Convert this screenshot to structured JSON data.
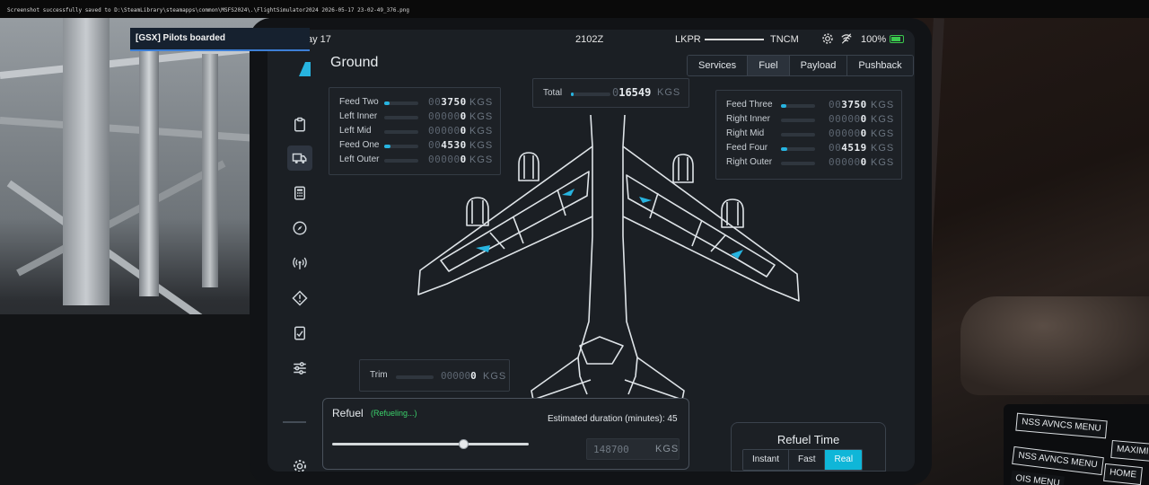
{
  "system_notice": "Screenshot successfully saved to D:\\SteamLibrary\\steamapps\\common\\MSFS2024\\.\\FlightSimulator2024 2026-05-17 23-02-49_376.png",
  "toast": "[GSX] Pilots boarded",
  "status_bar": {
    "date": "ay 17",
    "zulu_time": "2102Z",
    "departure": "LKPR",
    "arrival": "TNCM",
    "battery": "100%",
    "battery_color": "#3ac94d"
  },
  "page_title": "Ground",
  "tabs": [
    "Services",
    "Fuel",
    "Payload",
    "Pushback"
  ],
  "active_tab": "Fuel",
  "accent_color": "#27b4e0",
  "nav_icons": [
    "clipboard-icon",
    "truck-icon",
    "calculator-icon",
    "compass-icon",
    "radio-signal-icon",
    "warning-icon",
    "checklist-icon",
    "sliders-icon",
    "settings-icon"
  ],
  "left_tanks": [
    {
      "name": "Feed Two",
      "lead": "00",
      "value": "3750",
      "unit": "KGS",
      "level": 0.15
    },
    {
      "name": "Left Inner",
      "lead": "00000",
      "value": "0",
      "unit": "KGS",
      "level": 0
    },
    {
      "name": "Left Mid",
      "lead": "00000",
      "value": "0",
      "unit": "KGS",
      "level": 0
    },
    {
      "name": "Feed One",
      "lead": "00",
      "value": "4530",
      "unit": "KGS",
      "level": 0.18
    },
    {
      "name": "Left Outer",
      "lead": "00000",
      "value": "0",
      "unit": "KGS",
      "level": 0
    }
  ],
  "right_tanks": [
    {
      "name": "Feed Three",
      "lead": "00",
      "value": "3750",
      "unit": "KGS",
      "level": 0.15
    },
    {
      "name": "Right Inner",
      "lead": "00000",
      "value": "0",
      "unit": "KGS",
      "level": 0
    },
    {
      "name": "Right Mid",
      "lead": "00000",
      "value": "0",
      "unit": "KGS",
      "level": 0
    },
    {
      "name": "Feed Four",
      "lead": "00",
      "value": "4519",
      "unit": "KGS",
      "level": 0.18
    },
    {
      "name": "Right Outer",
      "lead": "00000",
      "value": "0",
      "unit": "KGS",
      "level": 0
    }
  ],
  "total": {
    "label": "Total",
    "lead": "0",
    "value": "16549",
    "unit": "KGS",
    "level": 0.07
  },
  "trim": {
    "label": "Trim",
    "lead": "00000",
    "value": "0",
    "unit": "KGS",
    "level": 0
  },
  "refuel": {
    "title": "Refuel",
    "status": "(Refueling...)",
    "estimate_label": "Estimated duration (minutes): 45",
    "slider_level": 0.67,
    "target_value": "148700",
    "target_unit": "KGS"
  },
  "refuel_time": {
    "title": "Refuel Time",
    "options": [
      "Instant",
      "Fast",
      "Real"
    ],
    "active": "Real"
  },
  "cockpit_buttons": [
    "NSS AVNCS MENU",
    "MAXIMI",
    "NSS AVNCS MENU",
    "HOME",
    "OIS MENU"
  ]
}
